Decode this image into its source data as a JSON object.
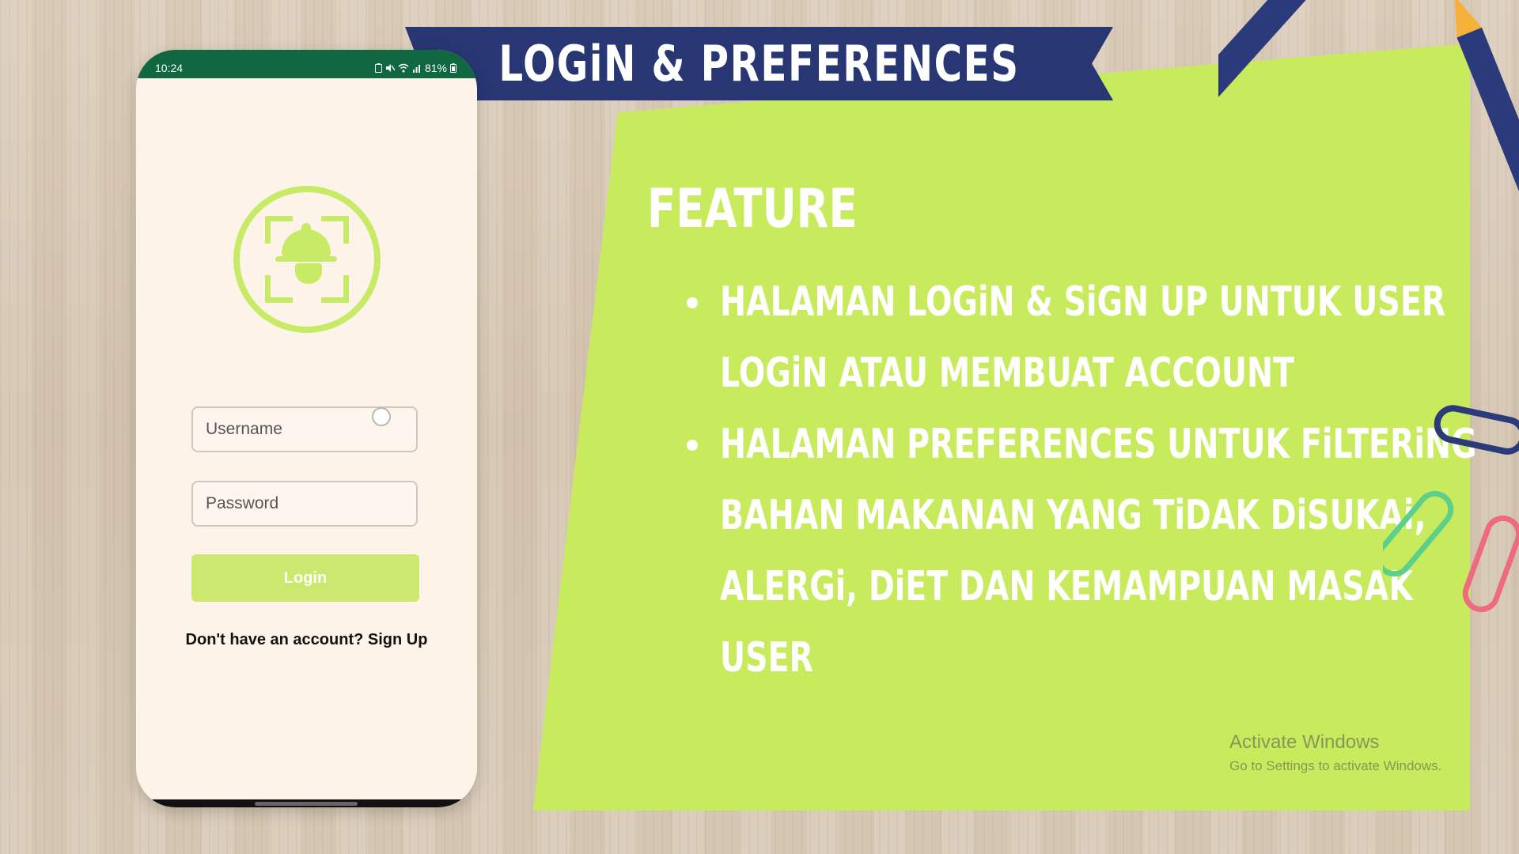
{
  "phone": {
    "status_time": "10:24",
    "battery": "81%",
    "username_placeholder": "Username",
    "password_placeholder": "Password",
    "login_label": "Login",
    "signup_prompt": "Don't have an account? Sign Up"
  },
  "banner": {
    "title": "LOGiN & PREFERENCES"
  },
  "content": {
    "feature_title": "FEATURE",
    "bullets": [
      "HALAMAN LOGiN & SiGN UP UNTUK USER LOGiN ATAU MEMBUAT ACCOUNT",
      "HALAMAN PREFERENCES UNTUK FiLTERiNG BAHAN MAKANAN YANG TiDAK DiSUKAi, ALERGi, DiET DAN KEMAMPUAN MASAK USER"
    ]
  },
  "watermark": {
    "line1": "Activate Windows",
    "line2": "Go to Settings to activate Windows."
  },
  "colors": {
    "panel_green": "#c8eb5e",
    "banner_navy": "#283673",
    "status_green": "#106841",
    "accent_lime": "#cde86f"
  }
}
